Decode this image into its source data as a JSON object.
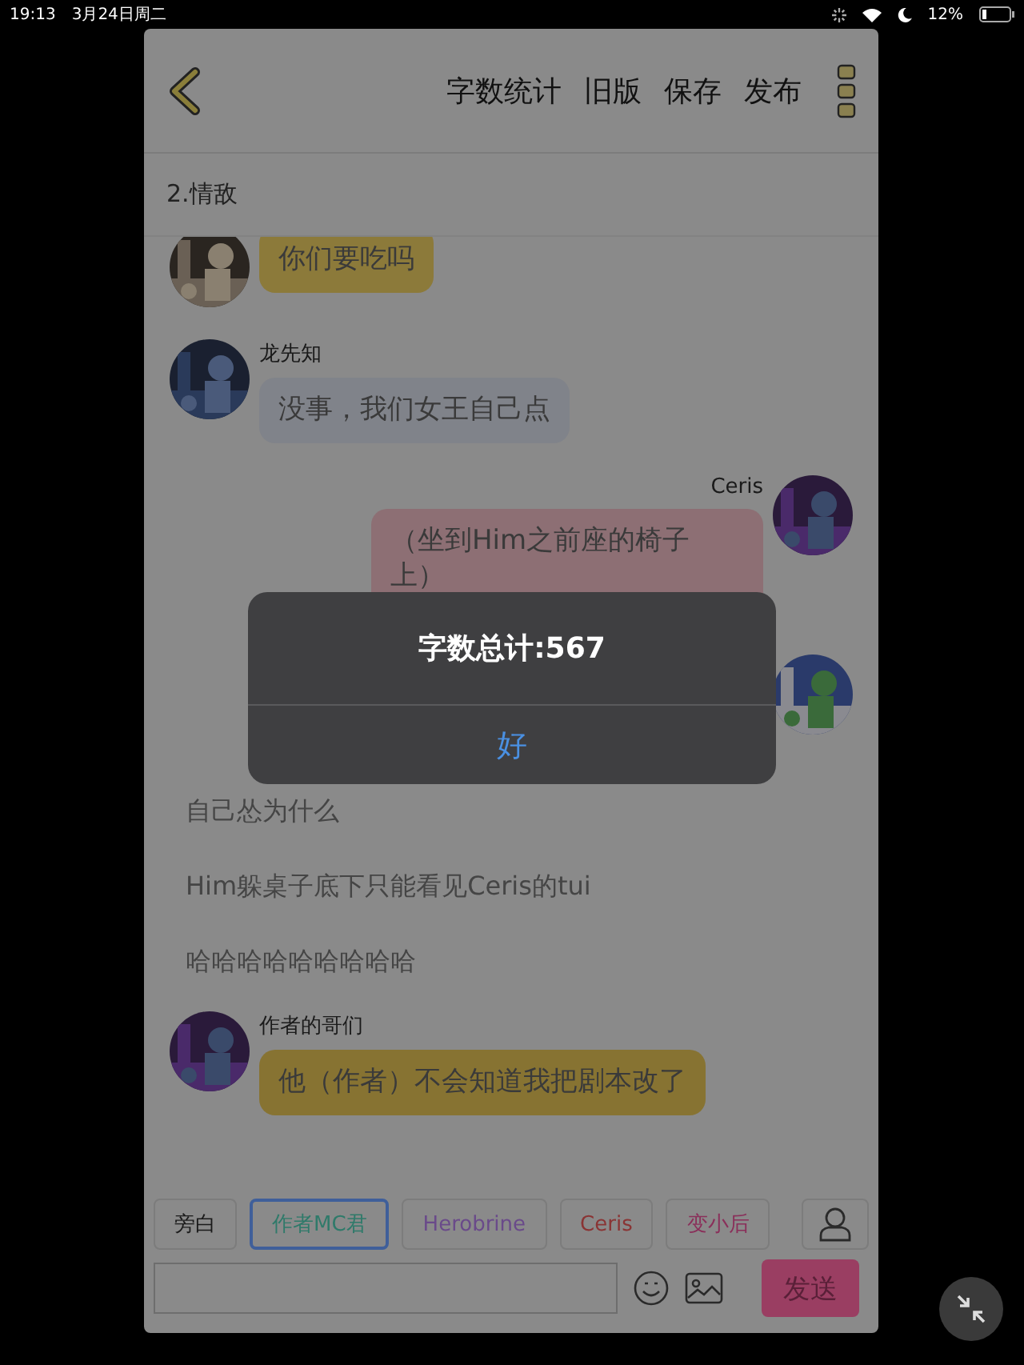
{
  "status_bar": {
    "time": "19:13",
    "date": "3月24日周二",
    "battery": "12%"
  },
  "toolbar": {
    "actions": [
      "字数统计",
      "旧版",
      "保存",
      "发布"
    ]
  },
  "chapter_title": "2.情敌",
  "messages": [
    {
      "kind": "left",
      "text": "你们要吃吗",
      "color": "#8c7a3a"
    },
    {
      "kind": "left",
      "name": "龙先知",
      "text": "没事，我们女王自己点",
      "color": "#80838a"
    },
    {
      "kind": "right",
      "name": "Ceris",
      "text": "（坐到Him之前座的椅子上）",
      "color": "#8d6f74"
    },
    {
      "kind": "avatar_only"
    },
    {
      "kind": "narration",
      "text": "自己怂为什么"
    },
    {
      "kind": "narration",
      "text": "Him躲桌子底下只能看见Ceris的tui"
    },
    {
      "kind": "narration",
      "text": "哈哈哈哈哈哈哈哈哈"
    },
    {
      "kind": "left",
      "name": "作者的哥们",
      "text": "他（作者）不会知道我把剧本改了",
      "color": "#877332"
    }
  ],
  "roles": [
    {
      "label": "旁白",
      "color": "#1a1a1a",
      "selected": false
    },
    {
      "label": "作者MC君",
      "color": "#2f7a6a",
      "selected": true
    },
    {
      "label": "Herobrine",
      "color": "#6a4a8a",
      "selected": false
    },
    {
      "label": "Ceris",
      "color": "#8a3434",
      "selected": false
    },
    {
      "label": "变小后",
      "color": "#8a2f5a",
      "selected": false
    }
  ],
  "composer": {
    "send": "发送"
  },
  "alert": {
    "message": "字数总计:567",
    "button": "好"
  }
}
